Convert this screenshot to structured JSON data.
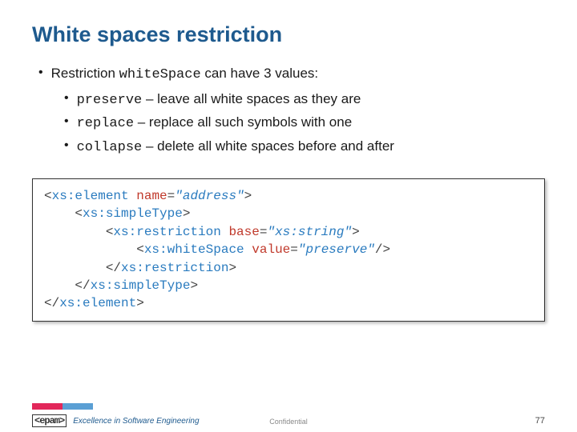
{
  "title": "White spaces restriction",
  "bullets": {
    "intro_pre": "Restriction ",
    "intro_code": "whiteSpace",
    "intro_post": " can have 3 values:",
    "items": [
      {
        "code": "preserve",
        "desc": " – leave all white spaces as they are"
      },
      {
        "code": "replace",
        "desc": " – replace all such symbols with one"
      },
      {
        "code": "collapse",
        "desc": " – delete all white spaces before and after"
      }
    ]
  },
  "code": {
    "l1_open": "<",
    "l1_tag": "xs:element",
    "l1_sp": " ",
    "l1_attr": "name",
    "l1_eq": "=",
    "l1_val": "\"address\"",
    "l1_close": ">",
    "l2_pre": "    <",
    "l2_tag": "xs:simpleType",
    "l2_close": ">",
    "l3_pre": "        <",
    "l3_tag": "xs:restriction",
    "l3_sp": " ",
    "l3_attr": "base",
    "l3_eq": "=",
    "l3_val": "\"xs:string\"",
    "l3_close": ">",
    "l4_pre": "            <",
    "l4_tag": "xs:whiteSpace",
    "l4_sp": " ",
    "l4_attr": "value",
    "l4_eq": "=",
    "l4_val": "\"preserve\"",
    "l4_close": "/>",
    "l5_pre": "        </",
    "l5_tag": "xs:restriction",
    "l5_close": ">",
    "l6_pre": "    </",
    "l6_tag": "xs:simpleType",
    "l6_close": ">",
    "l7_pre": "</",
    "l7_tag": "xs:element",
    "l7_close": ">"
  },
  "footer": {
    "logo_mark": "<epam>",
    "logo_text": "Excellence in Software Engineering",
    "confidential": "Confidential",
    "page": "77"
  }
}
